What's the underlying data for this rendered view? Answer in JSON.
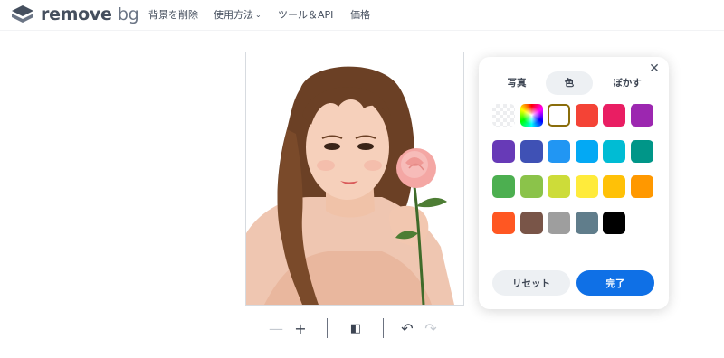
{
  "brand": {
    "word1": "remove",
    "word2": "bg"
  },
  "nav": {
    "links": [
      {
        "label": "背景を削除"
      },
      {
        "label": "使用方法",
        "chevron": "⌄"
      },
      {
        "label": "ツール＆API"
      },
      {
        "label": "価格"
      }
    ]
  },
  "toolbar": {
    "zoom_out_icon": "—",
    "zoom_in_icon": "+",
    "compare_icon": "◧",
    "undo_icon": "↶",
    "redo_icon": "↷"
  },
  "panel": {
    "close_icon": "✕",
    "tabs": [
      {
        "label": "写真",
        "active": false
      },
      {
        "label": "色",
        "active": true
      },
      {
        "label": "ぼかす",
        "active": false
      }
    ],
    "swatches": [
      {
        "name": "transparent",
        "color": "transparent"
      },
      {
        "name": "rainbow",
        "color": "rainbow"
      },
      {
        "name": "white",
        "color": "#ffffff",
        "selected": true
      },
      {
        "name": "red",
        "color": "#f44336"
      },
      {
        "name": "pink",
        "color": "#e91e63"
      },
      {
        "name": "purple",
        "color": "#9c27b0"
      },
      {
        "name": "deep-purple",
        "color": "#673ab7"
      },
      {
        "name": "indigo",
        "color": "#3f51b5"
      },
      {
        "name": "blue",
        "color": "#2196f3"
      },
      {
        "name": "light-blue",
        "color": "#03a9f4"
      },
      {
        "name": "cyan",
        "color": "#00bcd4"
      },
      {
        "name": "teal",
        "color": "#009688"
      },
      {
        "name": "green",
        "color": "#4caf50"
      },
      {
        "name": "light-green",
        "color": "#8bc34a"
      },
      {
        "name": "lime",
        "color": "#cddc39"
      },
      {
        "name": "yellow",
        "color": "#ffeb3b"
      },
      {
        "name": "amber",
        "color": "#ffc107"
      },
      {
        "name": "orange",
        "color": "#ff9800"
      },
      {
        "name": "deep-orange",
        "color": "#ff5722"
      },
      {
        "name": "brown",
        "color": "#795548"
      },
      {
        "name": "grey",
        "color": "#9e9e9e"
      },
      {
        "name": "blue-grey",
        "color": "#607d8b"
      },
      {
        "name": "black",
        "color": "#000000"
      }
    ],
    "reset_label": "リセット",
    "done_label": "完了"
  },
  "colors": {
    "accent": "#0f70e6",
    "tab_bg": "#edf0f3",
    "text": "#454f5e"
  }
}
